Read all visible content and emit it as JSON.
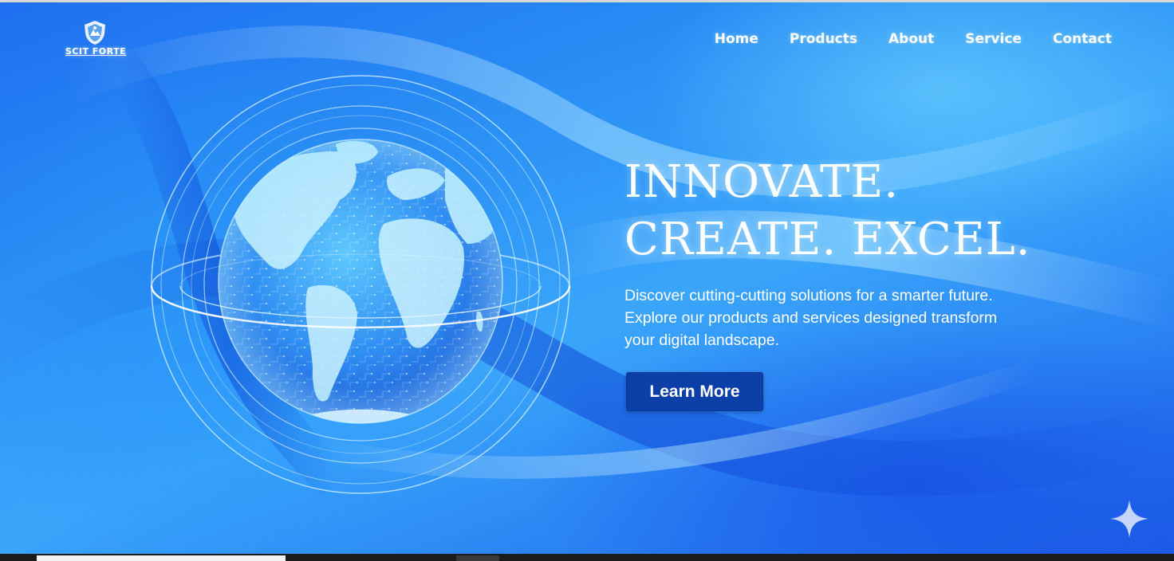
{
  "brand": {
    "logo_text": "SCIT FORTE",
    "logo_icon": "shield-logo-icon"
  },
  "nav": {
    "items": [
      "Home",
      "Products",
      "About",
      "Service",
      "Contact"
    ]
  },
  "hero": {
    "headline_line1": "INNOVATE.",
    "headline_line2": "CREATE. EXCEL.",
    "subtext": "Discover cutting-cutting solutions for a smarter future. Explore our products and services designed transform your digital landscape.",
    "cta_label": "Learn More",
    "illustration": "digital-globe-icon"
  },
  "colors": {
    "hero_gradient_start": "#1e6ff0",
    "hero_gradient_mid": "#3aa6fb",
    "cta_background": "#0c3fa8",
    "text": "#ffffff"
  },
  "overlay": {
    "icon": "sparkle-icon"
  }
}
